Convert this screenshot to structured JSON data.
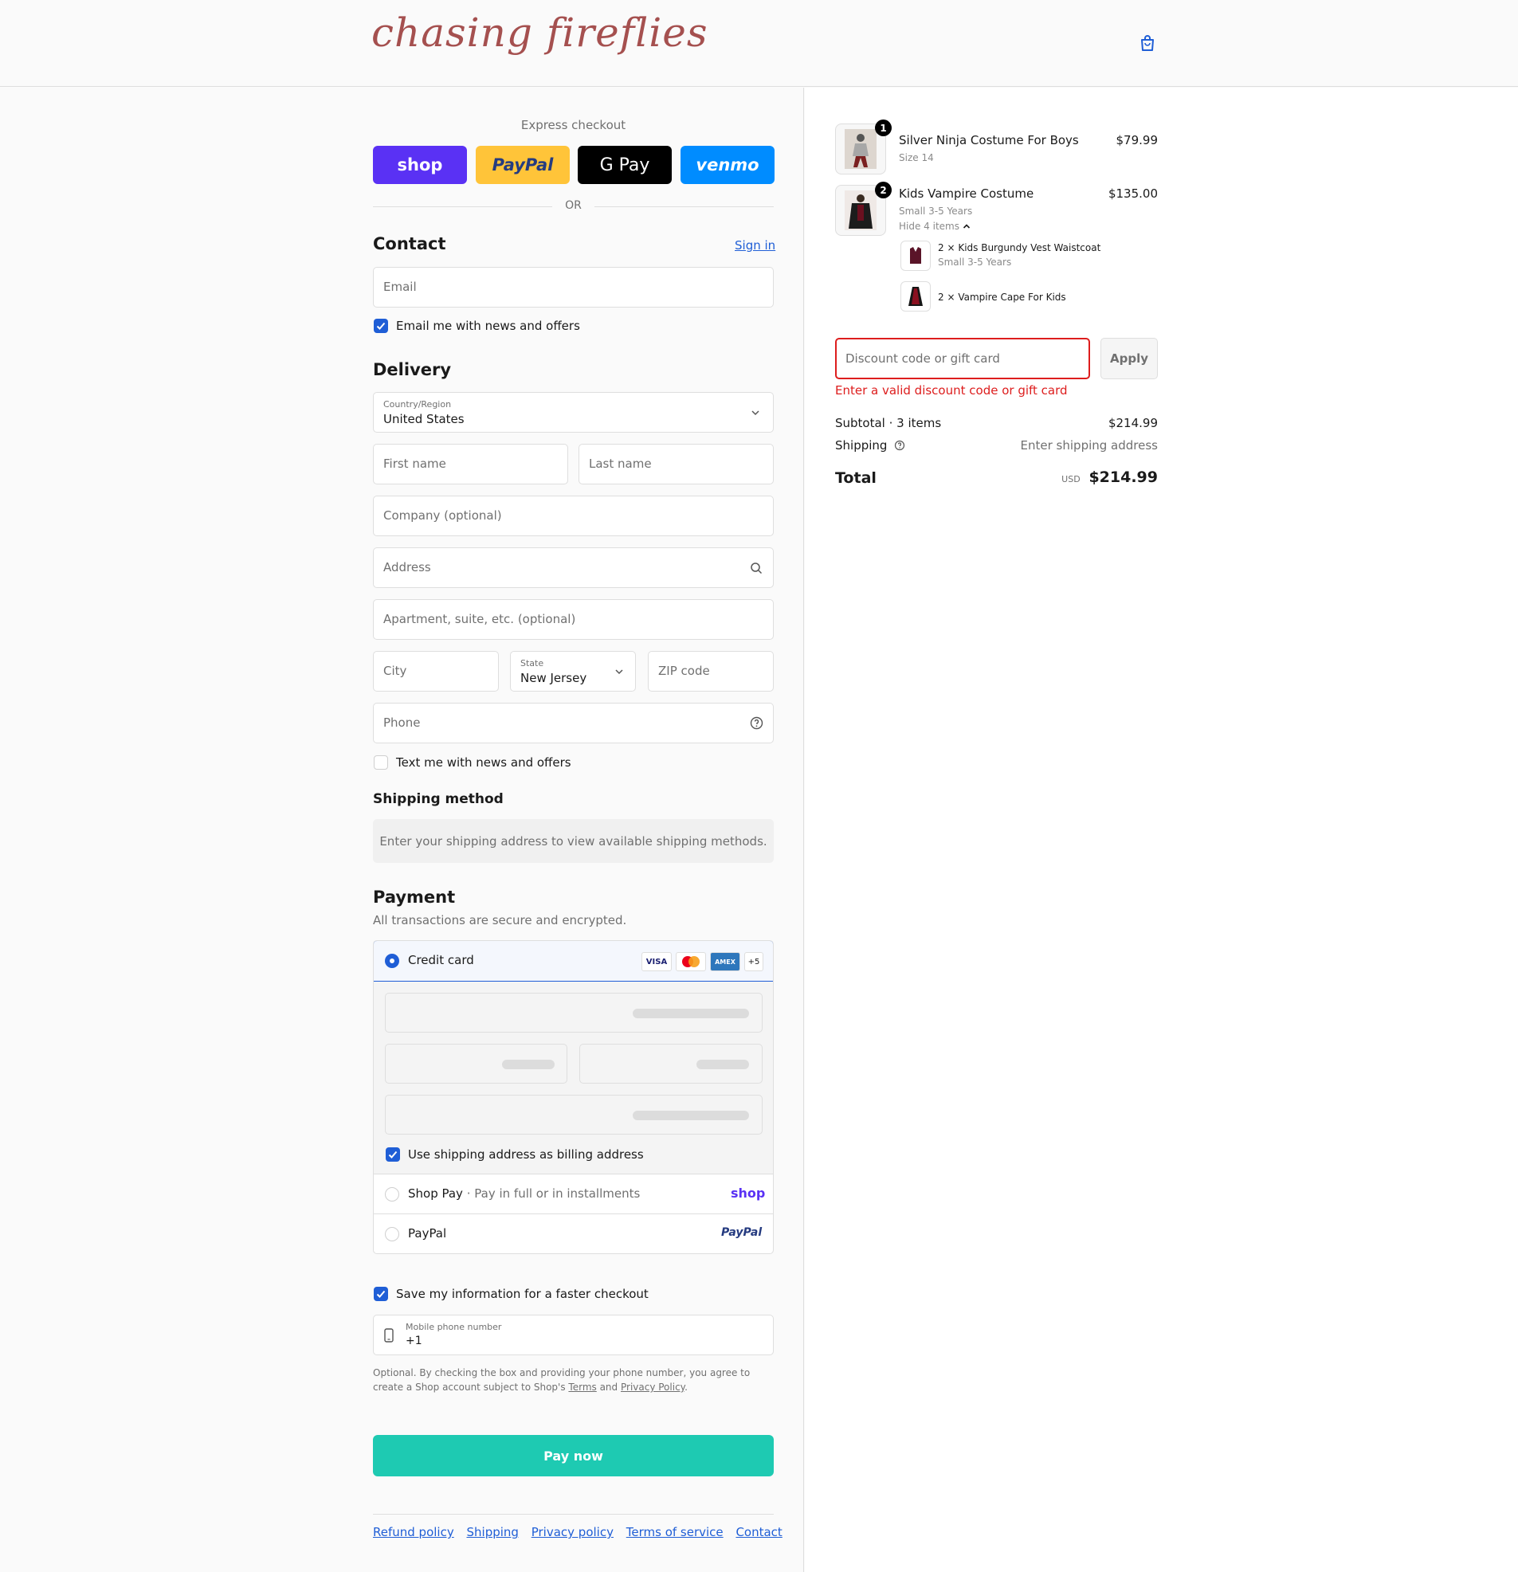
{
  "brand": {
    "logo_text": "chasing fireflies",
    "accent": "#1f5ed6",
    "logo_color": "#a5504f"
  },
  "express": {
    "label": "Express checkout",
    "buttons": [
      {
        "label": "shop",
        "color": "#5a31f4"
      },
      {
        "label": "PayPal",
        "color": "#ffc439"
      },
      {
        "label": "G Pay",
        "color": "#000000"
      },
      {
        "label": "venmo",
        "color": "#008cff"
      }
    ],
    "or_label": "OR"
  },
  "contact": {
    "title": "Contact",
    "sign_in": "Sign in",
    "email_placeholder": "Email",
    "news_label": "Email me with news and offers"
  },
  "delivery": {
    "title": "Delivery",
    "country_label": "Country/Region",
    "country_value": "United States",
    "first_name": "First name",
    "last_name": "Last name",
    "company": "Company (optional)",
    "address": "Address",
    "apartment": "Apartment, suite, etc. (optional)",
    "city": "City",
    "state_label": "State",
    "state_value": "New Jersey",
    "zip": "ZIP code",
    "phone": "Phone",
    "text_label": "Text me with news and offers"
  },
  "shipping_method": {
    "title": "Shipping method",
    "message": "Enter your shipping address to view available shipping methods."
  },
  "payment": {
    "title": "Payment",
    "subtitle": "All transactions are secure and encrypted.",
    "credit_card": "Credit card",
    "cards": [
      "VISA",
      "MC",
      "AMEX"
    ],
    "more_cards": "+5",
    "billing_label": "Use shipping address as billing address",
    "shop_pay": "Shop Pay",
    "shop_pay_sub": "Pay in full or in installments",
    "shop_pay_logo": "shop",
    "paypal": "PayPal",
    "paypal_logo": "PayPal"
  },
  "save": {
    "label": "Save my information for a faster checkout",
    "mobile_label": "Mobile phone number",
    "mobile_value": "+1",
    "legal_1": "Optional. By checking the box and providing your phone number, you agree to",
    "legal_2a": "create a Shop account subject to Shop's ",
    "terms": "Terms",
    "and": " and ",
    "privacy": "Privacy Policy",
    "period": "."
  },
  "pay_now": "Pay now",
  "footer": [
    "Refund policy",
    "Shipping",
    "Privacy policy",
    "Terms of service",
    "Contact"
  ],
  "cart": {
    "items": [
      {
        "qty": "1",
        "name": "Silver Ninja Costume For Boys",
        "variant": "Size 14",
        "price": "$79.99"
      },
      {
        "qty": "2",
        "name": "Kids Vampire Costume",
        "variant": "Small 3-5 Years",
        "price": "$135.00",
        "toggle": "Hide 4 items"
      }
    ],
    "sub_items": [
      {
        "name": "2 × Kids Burgundy Vest Waistcoat",
        "variant": "Small 3-5 Years"
      },
      {
        "name": "2 × Vampire Cape For Kids"
      }
    ],
    "discount_placeholder": "Discount code or gift card",
    "apply": "Apply",
    "error": "Enter a valid discount code or gift card",
    "subtotal_label": "Subtotal · 3 items",
    "subtotal_value": "$214.99",
    "shipping_label": "Shipping",
    "shipping_value": "Enter shipping address",
    "total_label": "Total",
    "currency": "USD",
    "total_value": "$214.99"
  }
}
